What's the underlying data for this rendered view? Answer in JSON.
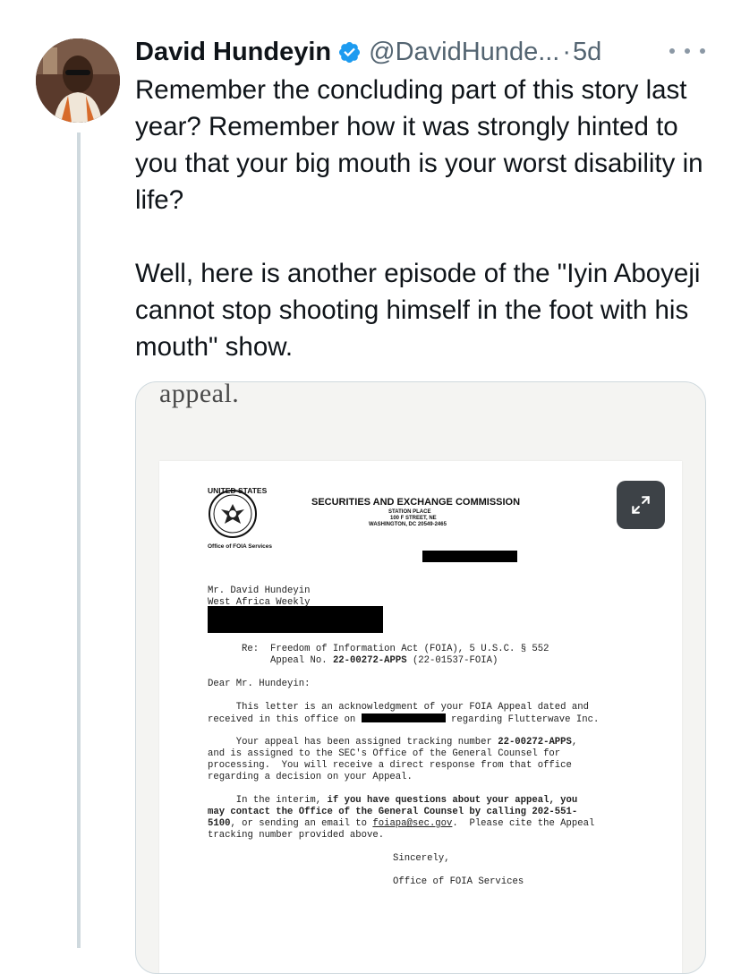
{
  "tweet": {
    "author_name": "David Hundeyin",
    "handle": "@DavidHunde...",
    "separator": "·",
    "time_ago": "5d",
    "paragraph_1": "Remember the concluding part of this story last year? Remember how it was strongly hinted to you that your big mouth is your worst disability in life?",
    "paragraph_2": "Well, here is another episode of the \"Iyin Aboyeji cannot stop shooting himself in the foot with his mouth\" show."
  },
  "media": {
    "caption_fragment": "appeal.",
    "letter": {
      "org_short": "UNITED STATES",
      "org_name": "SECURITIES AND EXCHANGE COMMISSION",
      "address_1": "STATION PLACE",
      "address_2": "100 F STREET, NE",
      "address_3": "WASHINGTON, DC  20549-2465",
      "office": "Office of FOIA Services",
      "recipient_name": "Mr. David Hundeyin",
      "recipient_org": "West Africa Weekly",
      "re_label": "Re:",
      "re_line_1": "Freedom of Information Act (FOIA), 5 U.S.C. § 552",
      "re_line_2_prefix": "Appeal No. ",
      "re_line_2_number": "22-00272-APPS",
      "re_line_2_suffix": " (22-01537-FOIA)",
      "salutation": "Dear Mr. Hundeyin:",
      "p1_a": "     This letter is an acknowledgment of your FOIA Appeal dated and",
      "p1_b_prefix": "received in this office on ",
      "p1_b_suffix": " regarding Flutterwave Inc.",
      "p2_a_prefix": "     Your appeal has been assigned tracking number ",
      "p2_a_number": "22-00272-APPS",
      "p2_a_suffix": ",",
      "p2_b": "and is assigned to the SEC's Office of the General Counsel for",
      "p2_c": "processing.  You will receive a direct response from that office",
      "p2_d": "regarding a decision on your Appeal.",
      "p3_a_prefix": "     In the interim, ",
      "p3_a_bold": "if you have questions about your appeal, you",
      "p3_b_bold": "may contact the Office of the General Counsel by calling 202-551-",
      "p3_c_bold": "5100",
      "p3_c_mid": ", or sending an email to ",
      "p3_c_email": "foiapa@sec.gov",
      "p3_c_suffix": ".  Please cite the Appeal",
      "p3_d": "tracking number provided above.",
      "closing": "Sincerely,",
      "signature": "Office of FOIA Services"
    }
  },
  "icons": {
    "avatar": "avatar",
    "verified": "verified-badge-icon",
    "more": "more-icon",
    "expand": "expand-icon"
  },
  "colors": {
    "text": "#0f1419",
    "secondary": "#536471",
    "verified_blue": "#1d9bf0",
    "thread_line": "#cfd9de",
    "expand_button": "#3d4247"
  }
}
